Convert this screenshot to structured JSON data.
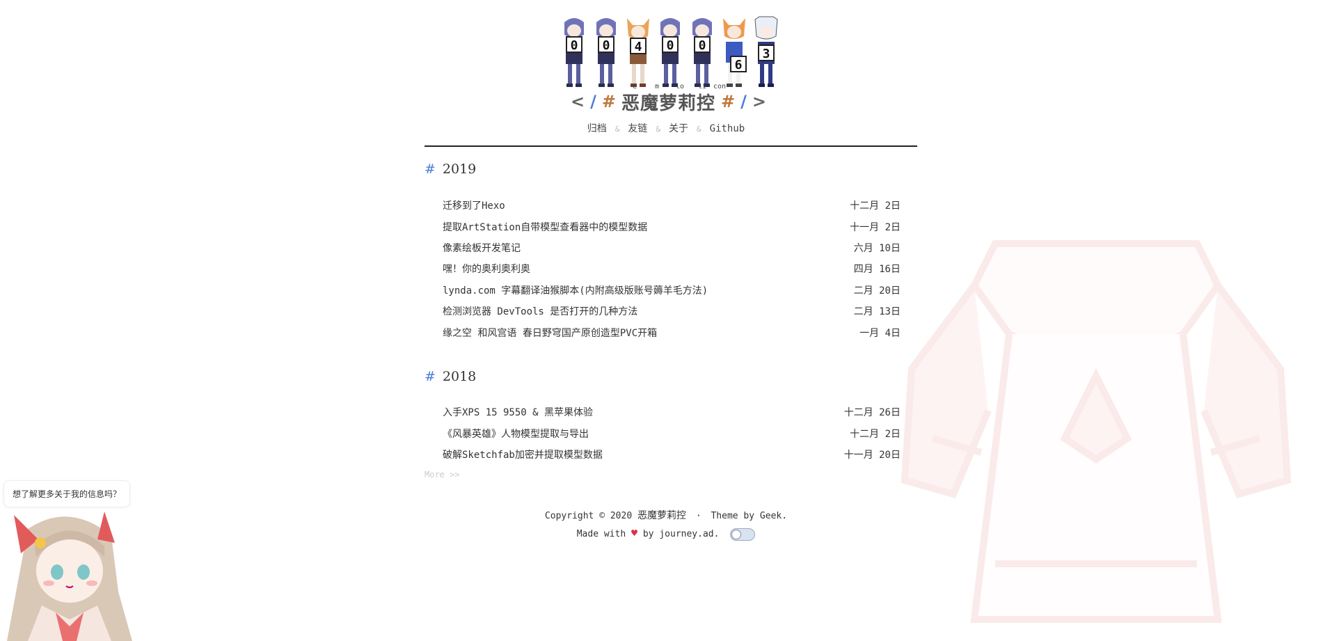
{
  "counter": {
    "digits": [
      "0",
      "0",
      "4",
      "0",
      "0",
      "6",
      "3"
    ]
  },
  "header": {
    "romaji": [
      "e",
      "m",
      "lo",
      "li",
      "con"
    ],
    "left_bracket": "<",
    "right_bracket": ">",
    "slash": "/",
    "hash": "#",
    "title": "恶魔萝莉控"
  },
  "nav": {
    "items": [
      "归档",
      "友链",
      "关于",
      "Github"
    ],
    "separator": "&"
  },
  "archive": [
    {
      "year": "2019",
      "posts": [
        {
          "title": "迁移到了Hexo",
          "date": "十二月 2日"
        },
        {
          "title": "提取ArtStation自带模型查看器中的模型数据",
          "date": "十一月 2日"
        },
        {
          "title": "像素绘板开发笔记",
          "date": "六月 10日"
        },
        {
          "title": "嘿！你的奥利奥利奥",
          "date": "四月 16日"
        },
        {
          "title": "lynda.com 字幕翻译油猴脚本(内附高级版账号薅羊毛方法)",
          "date": "二月 20日"
        },
        {
          "title": "检测浏览器 DevTools 是否打开的几种方法",
          "date": "二月 13日"
        },
        {
          "title": "缘之空 和风宫语 春日野穹国产原创造型PVC开箱",
          "date": "一月 4日"
        }
      ]
    },
    {
      "year": "2018",
      "posts": [
        {
          "title": "入手XPS 15 9550 & 黑苹果体验",
          "date": "十二月 26日"
        },
        {
          "title": "《风暴英雄》人物模型提取与导出",
          "date": "十二月 2日"
        },
        {
          "title": "破解Sketchfab加密并提取模型数据",
          "date": "十一月 20日"
        }
      ]
    }
  ],
  "more_link": "More >>",
  "footer": {
    "copyright_prefix": "Copyright © 2020",
    "site_name": "恶魔萝莉控",
    "dot": "·",
    "theme_prefix": "Theme by",
    "theme_name": "Geek.",
    "made_with": "Made with",
    "heart": "♥",
    "by_text": "by journey.ad."
  },
  "widget": {
    "tip": "想了解更多关于我的信息吗？"
  },
  "colors": {
    "accent": "#4a7ed6",
    "heart": "#d9304a",
    "hash_orange": "#c0763a"
  },
  "icons": [
    "heart-icon",
    "theme-toggle",
    "mascot-illustration",
    "background-costume-illustration"
  ]
}
